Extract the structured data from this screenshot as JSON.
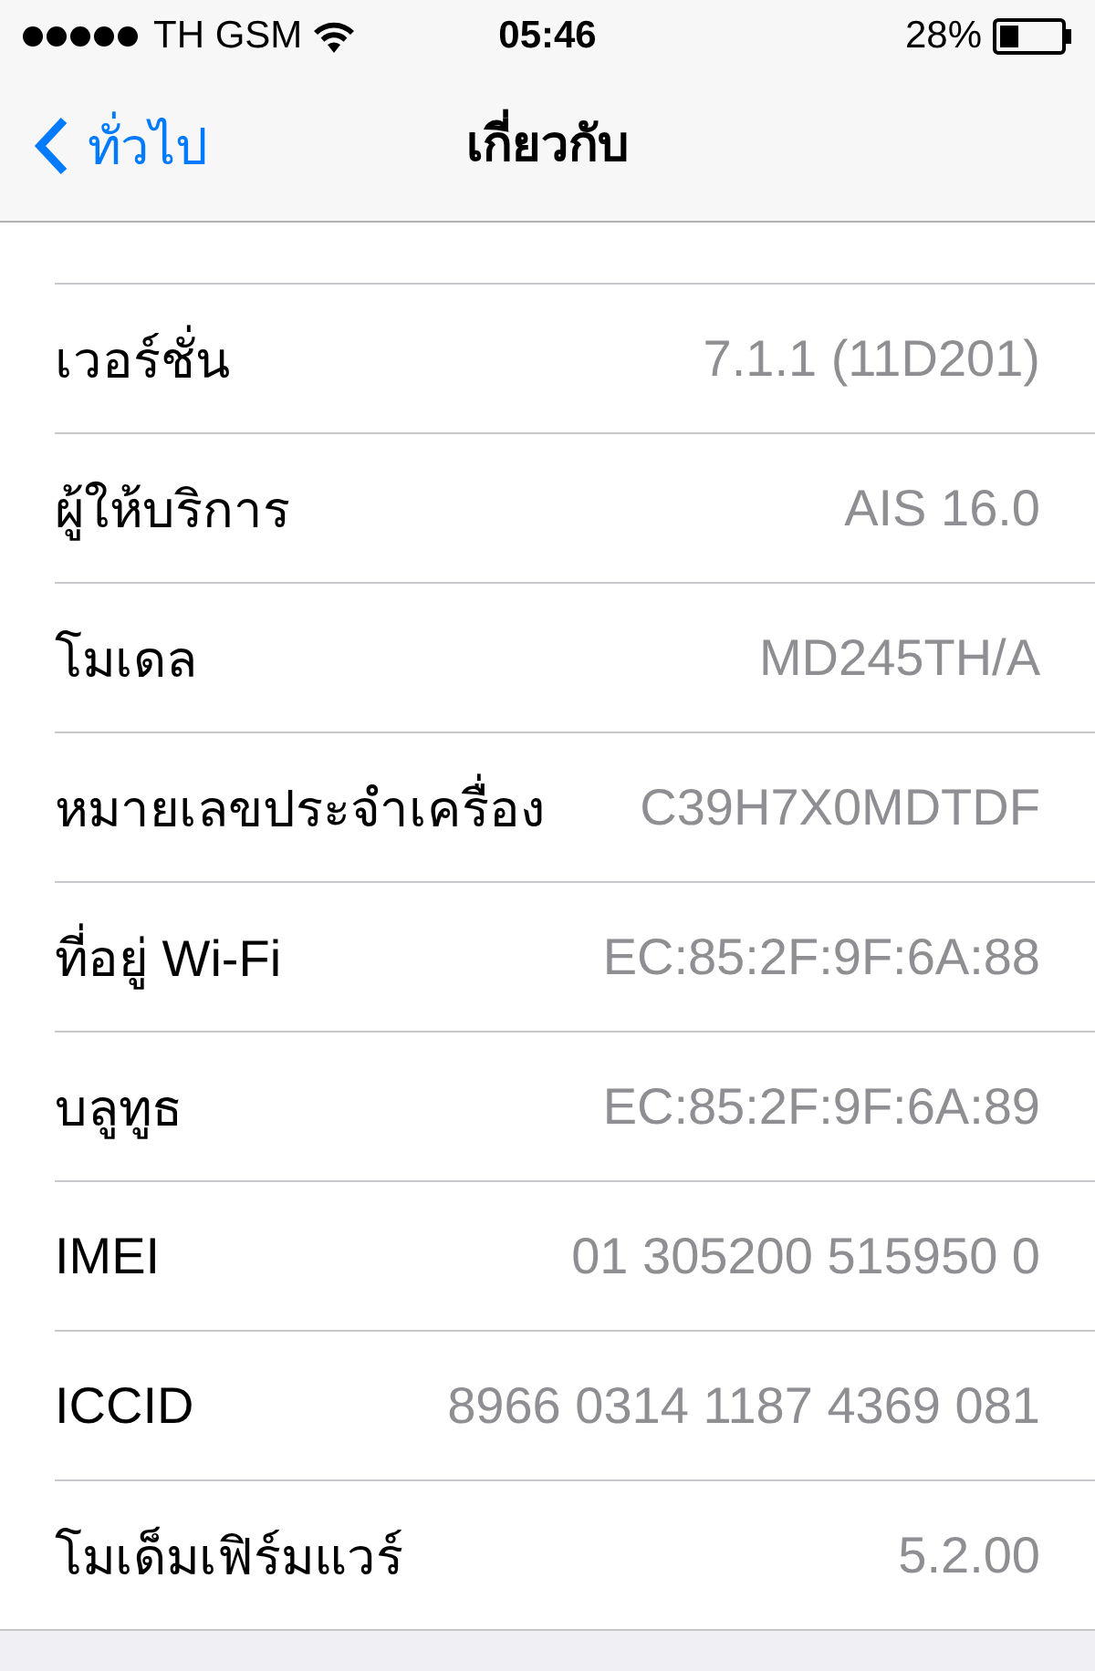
{
  "status_bar": {
    "carrier": "TH GSM",
    "time": "05:46",
    "battery": "28%"
  },
  "nav_bar": {
    "back": "ทั่วไป",
    "title": "เกี่ยวกับ"
  },
  "rows": [
    {
      "label": "เวอร์ชั่น",
      "value": "7.1.1 (11D201)"
    },
    {
      "label": "ผู้ให้บริการ",
      "value": "AIS 16.0"
    },
    {
      "label": "โมเดล",
      "value": "MD245TH/A"
    },
    {
      "label": "หมายเลขประจำเครื่อง",
      "value": "C39H7X0MDTDF"
    },
    {
      "label": "ที่อยู่ Wi-Fi",
      "value": "EC:85:2F:9F:6A:88"
    },
    {
      "label": "บลูทูธ",
      "value": "EC:85:2F:9F:6A:89"
    },
    {
      "label": "IMEI",
      "value": "01 305200 515950 0"
    },
    {
      "label": "ICCID",
      "value": "8966 0314 1187 4369 081"
    },
    {
      "label": "โมเด็มเฟิร์มแวร์",
      "value": "5.2.00"
    }
  ]
}
